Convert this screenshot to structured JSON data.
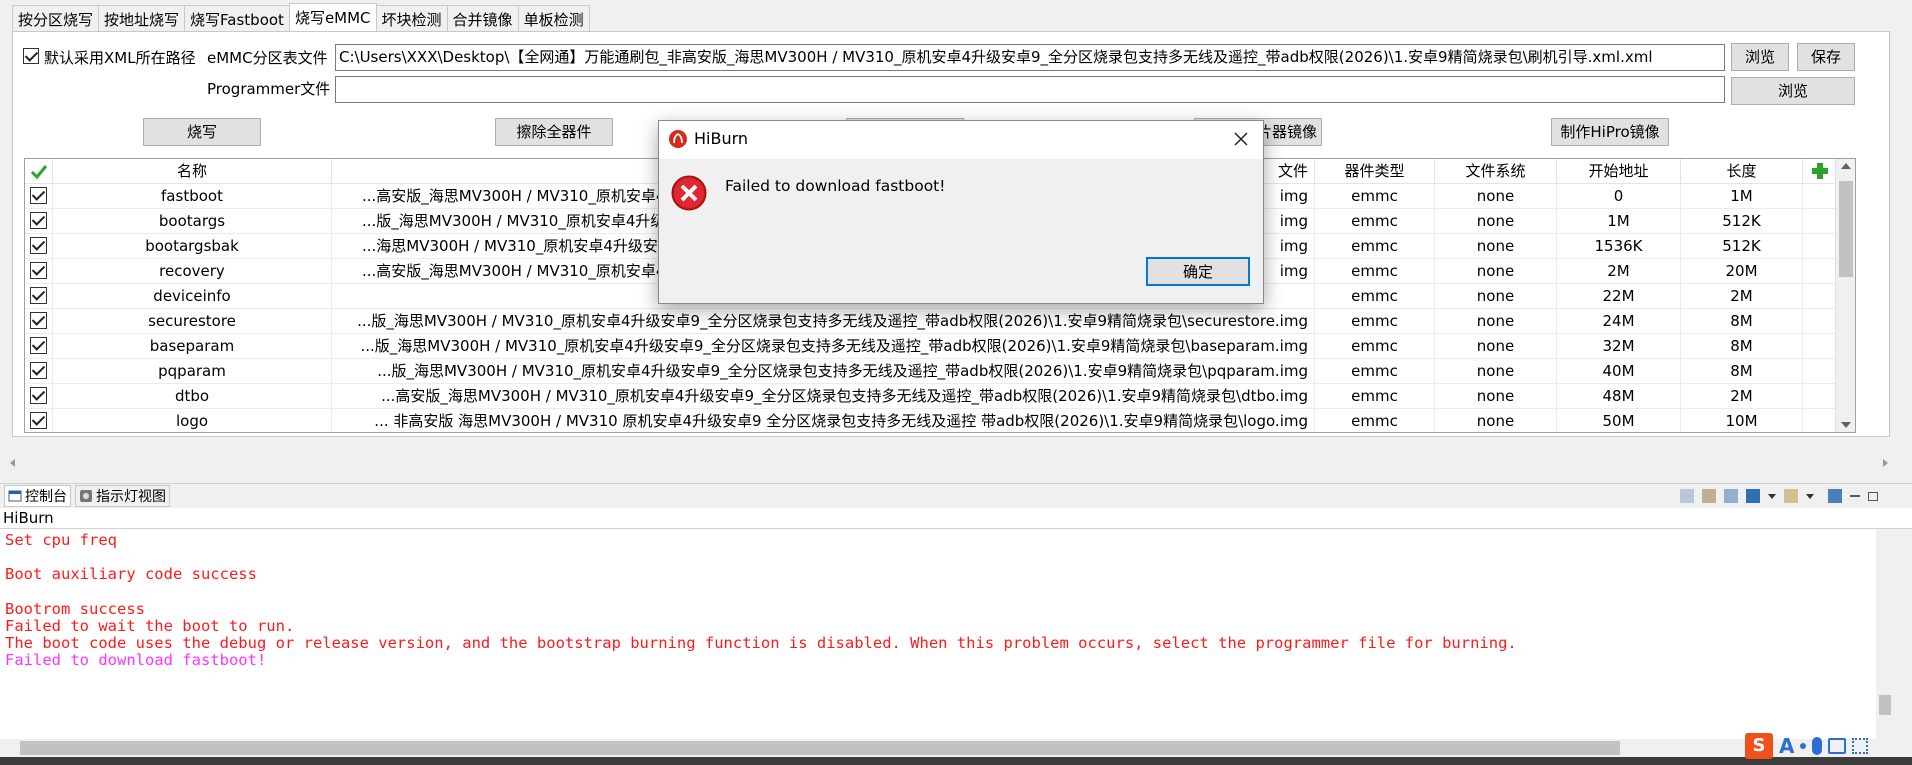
{
  "tabs": [
    "按分区烧写",
    "按地址烧写",
    "烧写Fastboot",
    "烧写eMMC",
    "坏块检测",
    "合并镜像",
    "单板检测"
  ],
  "options": {
    "default_xml_path_label": "默认采用XML所在路径",
    "emmc_table_label": "eMMC分区表文件",
    "emmc_table_value": "C:\\Users\\XXX\\Desktop\\【全网通】万能通刷包_非高安版_海思MV300H / MV310_原机安卓4升级安卓9_全分区烧录包支持多无线及遥控_带adb权限(2026)\\1.安卓9精简烧录包\\刷机引导.xml.xml",
    "programmer_label": "Programmer文件",
    "programmer_value": "",
    "browse_label": "浏览",
    "save_label": "保存",
    "browse2_label": "浏览"
  },
  "actions": {
    "burn": "烧写",
    "erase_all": "擦除全器件",
    "make_image": "烧片器镜像",
    "make_hipro": "制作HiPro镜像"
  },
  "grid": {
    "headers": {
      "name": "名称",
      "file": "文件",
      "device_type": "器件类型",
      "fs": "文件系统",
      "start": "开始地址",
      "length": "长度"
    },
    "rows": [
      {
        "name": "fastboot",
        "path_left": "...高安版_海思MV300H / MV310_原机安卓4升级",
        "path_right": "img",
        "type": "emmc",
        "fs": "none",
        "start": "0",
        "len": "1M"
      },
      {
        "name": "bootargs",
        "path_left": "...版_海思MV300H / MV310_原机安卓4升级",
        "path_right": "img",
        "type": "emmc",
        "fs": "none",
        "start": "1M",
        "len": "512K"
      },
      {
        "name": "bootargsbak",
        "path_left": "...海思MV300H / MV310_原机安卓4升级安卓",
        "path_right": "img",
        "type": "emmc",
        "fs": "none",
        "start": "1536K",
        "len": "512K"
      },
      {
        "name": "recovery",
        "path_left": "...高安版_海思MV300H / MV310_原机安卓4升级",
        "path_right": "img",
        "type": "emmc",
        "fs": "none",
        "start": "2M",
        "len": "20M"
      },
      {
        "name": "deviceinfo",
        "path_left": "",
        "path_right": "",
        "type": "emmc",
        "fs": "none",
        "start": "22M",
        "len": "2M"
      },
      {
        "name": "securestore",
        "path_full": "...版_海思MV300H / MV310_原机安卓4升级安卓9_全分区烧录包支持多无线及遥控_带adb权限(2026)\\1.安卓9精简烧录包\\securestore.img",
        "type": "emmc",
        "fs": "none",
        "start": "24M",
        "len": "8M"
      },
      {
        "name": "baseparam",
        "path_full": "...版_海思MV300H / MV310_原机安卓4升级安卓9_全分区烧录包支持多无线及遥控_带adb权限(2026)\\1.安卓9精简烧录包\\baseparam.img",
        "type": "emmc",
        "fs": "none",
        "start": "32M",
        "len": "8M"
      },
      {
        "name": "pqparam",
        "path_full": "...版_海思MV300H / MV310_原机安卓4升级安卓9_全分区烧录包支持多无线及遥控_带adb权限(2026)\\1.安卓9精简烧录包\\pqparam.img",
        "type": "emmc",
        "fs": "none",
        "start": "40M",
        "len": "8M"
      },
      {
        "name": "dtbo",
        "path_full": "...高安版_海思MV300H / MV310_原机安卓4升级安卓9_全分区烧录包支持多无线及遥控_带adb权限(2026)\\1.安卓9精简烧录包\\dtbo.img",
        "type": "emmc",
        "fs": "none",
        "start": "48M",
        "len": "2M"
      },
      {
        "name": "logo",
        "path_full": "... 非高安版 海思MV300H / MV310 原机安卓4升级安卓9 全分区烧录包支持多无线及遥控 带adb权限(2026)\\1.安卓9精简烧录包\\logo.img",
        "type": "emmc",
        "fs": "none",
        "start": "50M",
        "len": "10M"
      }
    ]
  },
  "dialog": {
    "title": "HiBurn",
    "message": "Failed to download fastboot!",
    "ok": "确定"
  },
  "bottom": {
    "tab_console": "控制台",
    "tab_led": "指示灯视图",
    "console_title": "HiBurn",
    "lines": [
      {
        "text": "Set cpu freq",
        "color": "red"
      },
      {
        "text": "",
        "color": "red"
      },
      {
        "text": "Boot auxiliary code success",
        "color": "red"
      },
      {
        "text": "",
        "color": "red"
      },
      {
        "text": "Bootrom success",
        "color": "red"
      },
      {
        "text": "Failed to wait the boot to run.",
        "color": "red"
      },
      {
        "text": "The boot code uses the debug or release version, and the bootstrap burning function is disabled. When this problem occurs, select the programmer file for burning.",
        "color": "red"
      },
      {
        "text": "Failed to download fastboot!",
        "color": "mag"
      }
    ]
  },
  "ime": {
    "letter": "A"
  }
}
